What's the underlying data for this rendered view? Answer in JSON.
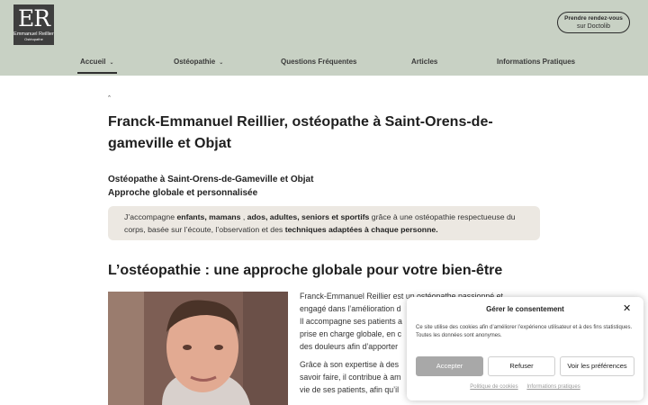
{
  "header": {
    "logo": {
      "letters": "ER",
      "name": "Emmanuel Reillier",
      "sub": "Ostéopathe"
    },
    "cta": {
      "line1": "Prendre rendez-vous",
      "line2": "sur Doctolib"
    },
    "nav": [
      {
        "label": "Accueil",
        "has_dropdown": true,
        "active": true
      },
      {
        "label": "Ostéopathie",
        "has_dropdown": true,
        "active": false
      },
      {
        "label": "Questions Fréquentes",
        "has_dropdown": false,
        "active": false
      },
      {
        "label": "Articles",
        "has_dropdown": false,
        "active": false
      },
      {
        "label": "Informations Pratiques",
        "has_dropdown": false,
        "active": false
      }
    ]
  },
  "main": {
    "title": "Franck-Emmanuel Reillier, ostéopathe à Saint-Orens-de-gameville et Objat",
    "subtitle_1": "Ostéopathe à Saint-Orens-de-Gameville et Objat",
    "subtitle_2": "Approche globale et personnalisée",
    "callout": {
      "t1": "J’accompagne ",
      "b1": "enfants, mamans",
      "t2": " , ",
      "b2": "ados, adultes, seniors et sportifs",
      "t3": " grâce à une ostéopathie respectueuse du corps, basée sur l’écoute, l’observation et des ",
      "b3": "techniques adaptées à chaque personne."
    },
    "section_title": "L’ostéopathie : une approche globale pour votre bien-être",
    "bio_lines": [
      "Franck-Emmanuel Reillier est un ostéopathe passionné et",
      "engagé dans l’amélioration d",
      "Il accompagne ses patients a",
      "prise en charge globale, en c",
      "des douleurs afin d’apporter"
    ],
    "bio_lines_2": [
      "Grâce à son expertise à des",
      "savoir faire, il contribue à am",
      "vie de ses patients, afin qu’il"
    ]
  },
  "cookie": {
    "title": "Gérer le consentement",
    "text": "Ce site utilise des cookies afin d’améliorer l’expérience utilisateur et à des fins statistiques. Toutes les données sont anonymes.",
    "accept": "Accepter",
    "refuse": "Refuser",
    "prefs": "Voir les préférences",
    "link1": "Politique de cookies",
    "link2": "Informations pratiques"
  },
  "colors": {
    "header_bg": "#c8d1c4",
    "logo_bg": "#3e3e3e",
    "callout_bg": "#ece8e2",
    "accept_bg": "#a8a8a8"
  },
  "icons": {
    "dropdown": "chevron-down-icon",
    "close": "close-icon",
    "home": "home-icon"
  }
}
